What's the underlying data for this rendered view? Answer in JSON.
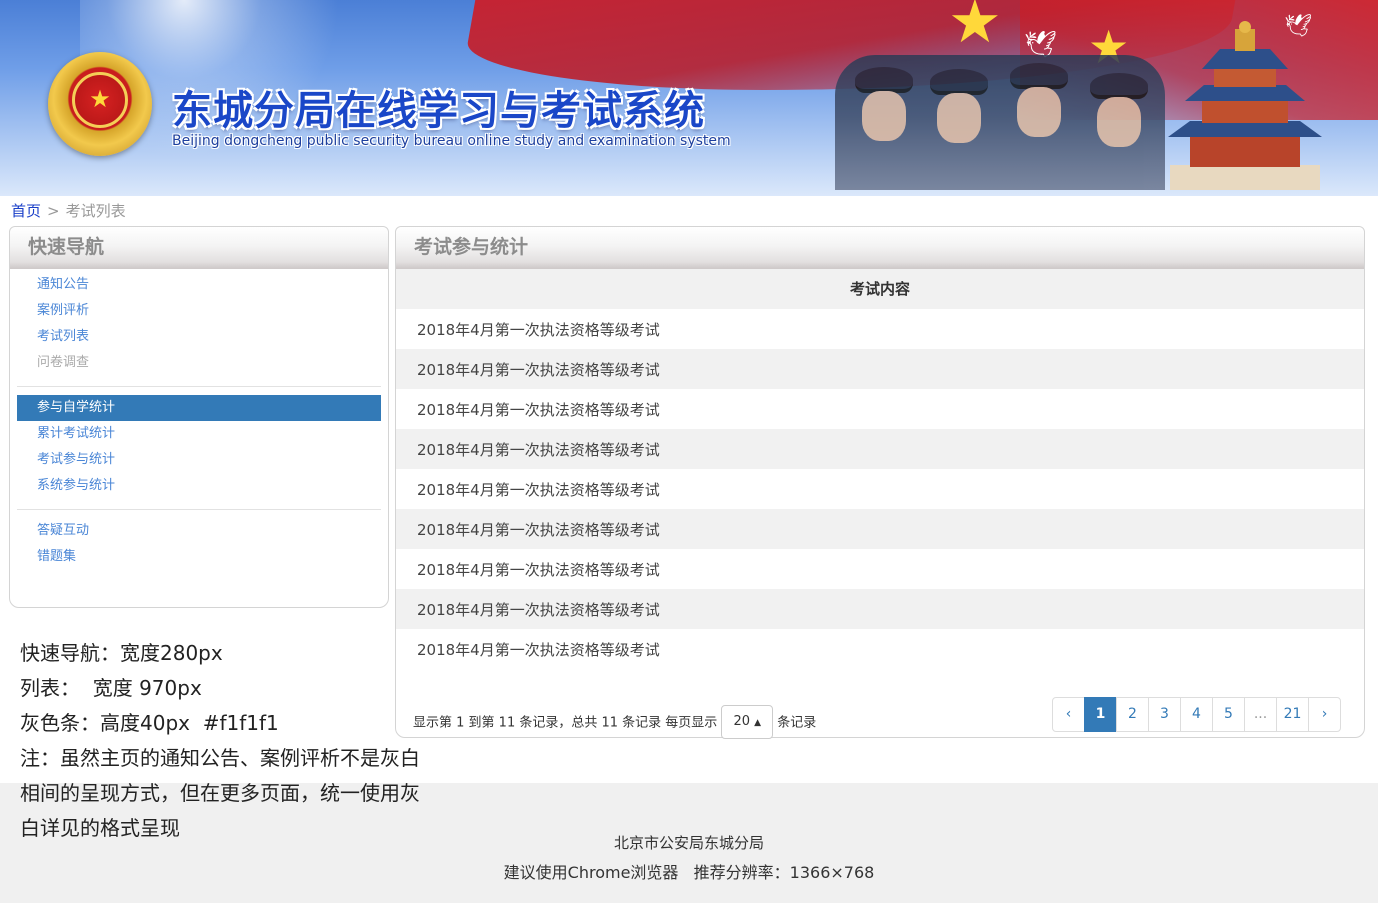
{
  "header": {
    "title_cn": "东城分局在线学习与考试系统",
    "title_en": "Beijing dongcheng public security bureau online study and examination system",
    "emblem_icon": "police-emblem-icon"
  },
  "breadcrumb": {
    "home": "首页",
    "separator": ">",
    "current": "考试列表"
  },
  "sidebar": {
    "title": "快速导航",
    "groups": [
      {
        "items": [
          {
            "label": "通知公告",
            "state": "normal"
          },
          {
            "label": "案例评析",
            "state": "normal"
          },
          {
            "label": "考试列表",
            "state": "normal"
          },
          {
            "label": "问卷调查",
            "state": "muted"
          }
        ]
      },
      {
        "items": [
          {
            "label": "参与自学统计",
            "state": "active"
          },
          {
            "label": "累计考试统计",
            "state": "normal"
          },
          {
            "label": "考试参与统计",
            "state": "normal"
          },
          {
            "label": "系统参与统计",
            "state": "normal"
          }
        ]
      },
      {
        "items": [
          {
            "label": "答疑互动",
            "state": "normal"
          },
          {
            "label": "错题集",
            "state": "normal"
          }
        ]
      }
    ]
  },
  "main": {
    "title": "考试参与统计",
    "column_header": "考试内容",
    "rows": [
      "2018年4月第一次执法资格等级考试",
      "2018年4月第一次执法资格等级考试",
      "2018年4月第一次执法资格等级考试",
      "2018年4月第一次执法资格等级考试",
      "2018年4月第一次执法资格等级考试",
      "2018年4月第一次执法资格等级考试",
      "2018年4月第一次执法资格等级考试",
      "2018年4月第一次执法资格等级考试",
      "2018年4月第一次执法资格等级考试"
    ],
    "pager": {
      "info_prefix": "显示第 1 到第 11 条记录，总共 11 条记录 每页显示",
      "page_size": "20",
      "caret": "▲",
      "info_suffix": "条记录",
      "prev": "‹",
      "pages": [
        "1",
        "2",
        "3",
        "4",
        "5",
        "...",
        "21"
      ],
      "active_page": "1",
      "next": "›"
    }
  },
  "notes": [
    "快速导航：宽度280px",
    "列表：  宽度 970px",
    "灰色条：高度40px  #f1f1f1",
    "注：虽然主页的通知公告、案例评析不是灰白",
    "相间的呈现方式，但在更多页面，统一使用灰",
    "白详见的格式呈现"
  ],
  "footer": {
    "org": "北京市公安局东城分局",
    "recommendation": "建议使用Chrome浏览器   推荐分辨率：1366×768"
  },
  "colors": {
    "accent": "#337ab7",
    "stripe": "#f1f1f1",
    "link": "#4a86d6",
    "footer_bg": "#f0f0f0"
  }
}
